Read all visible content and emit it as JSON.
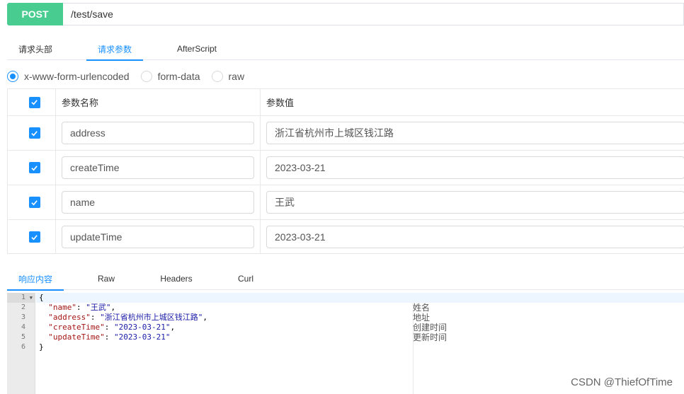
{
  "request": {
    "method": "POST",
    "url": "/test/save"
  },
  "request_tabs": [
    {
      "label": "请求头部",
      "active": false
    },
    {
      "label": "请求参数",
      "active": true
    },
    {
      "label": "AfterScript",
      "active": false
    }
  ],
  "body_types": [
    {
      "label": "x-www-form-urlencoded",
      "checked": true
    },
    {
      "label": "form-data",
      "checked": false
    },
    {
      "label": "raw",
      "checked": false
    }
  ],
  "params_table": {
    "header": {
      "name": "参数名称",
      "value": "参数值"
    },
    "rows": [
      {
        "name": "address",
        "value": "浙江省杭州市上城区钱江路",
        "checked": true
      },
      {
        "name": "createTime",
        "value": "2023-03-21",
        "checked": true
      },
      {
        "name": "name",
        "value": "王武",
        "checked": true
      },
      {
        "name": "updateTime",
        "value": "2023-03-21",
        "checked": true
      }
    ]
  },
  "response_tabs": [
    {
      "label": "响应内容",
      "active": true
    },
    {
      "label": "Raw",
      "active": false
    },
    {
      "label": "Headers",
      "active": false
    },
    {
      "label": "Curl",
      "active": false
    }
  ],
  "response_code": {
    "line_numbers": [
      "1",
      "2",
      "3",
      "4",
      "5",
      "6"
    ],
    "open_brace": "{",
    "close_brace": "}",
    "fields": [
      {
        "key": "\"name\"",
        "value": "\"王武\"",
        "comment": "姓名",
        "comma": true
      },
      {
        "key": "\"address\"",
        "value": "\"浙江省杭州市上城区钱江路\"",
        "comment": "地址",
        "comma": true
      },
      {
        "key": "\"createTime\"",
        "value": "\"2023-03-21\"",
        "comment": "创建时间",
        "comma": true
      },
      {
        "key": "\"updateTime\"",
        "value": "\"2023-03-21\"",
        "comment": "更新时间",
        "comma": false
      }
    ]
  },
  "watermark": "CSDN @ThiefOfTime",
  "icons": {
    "checkbox": "checkmark-icon",
    "fold": "fold-arrow-icon"
  },
  "colors": {
    "post": "#49cc90",
    "accent": "#1890ff"
  }
}
